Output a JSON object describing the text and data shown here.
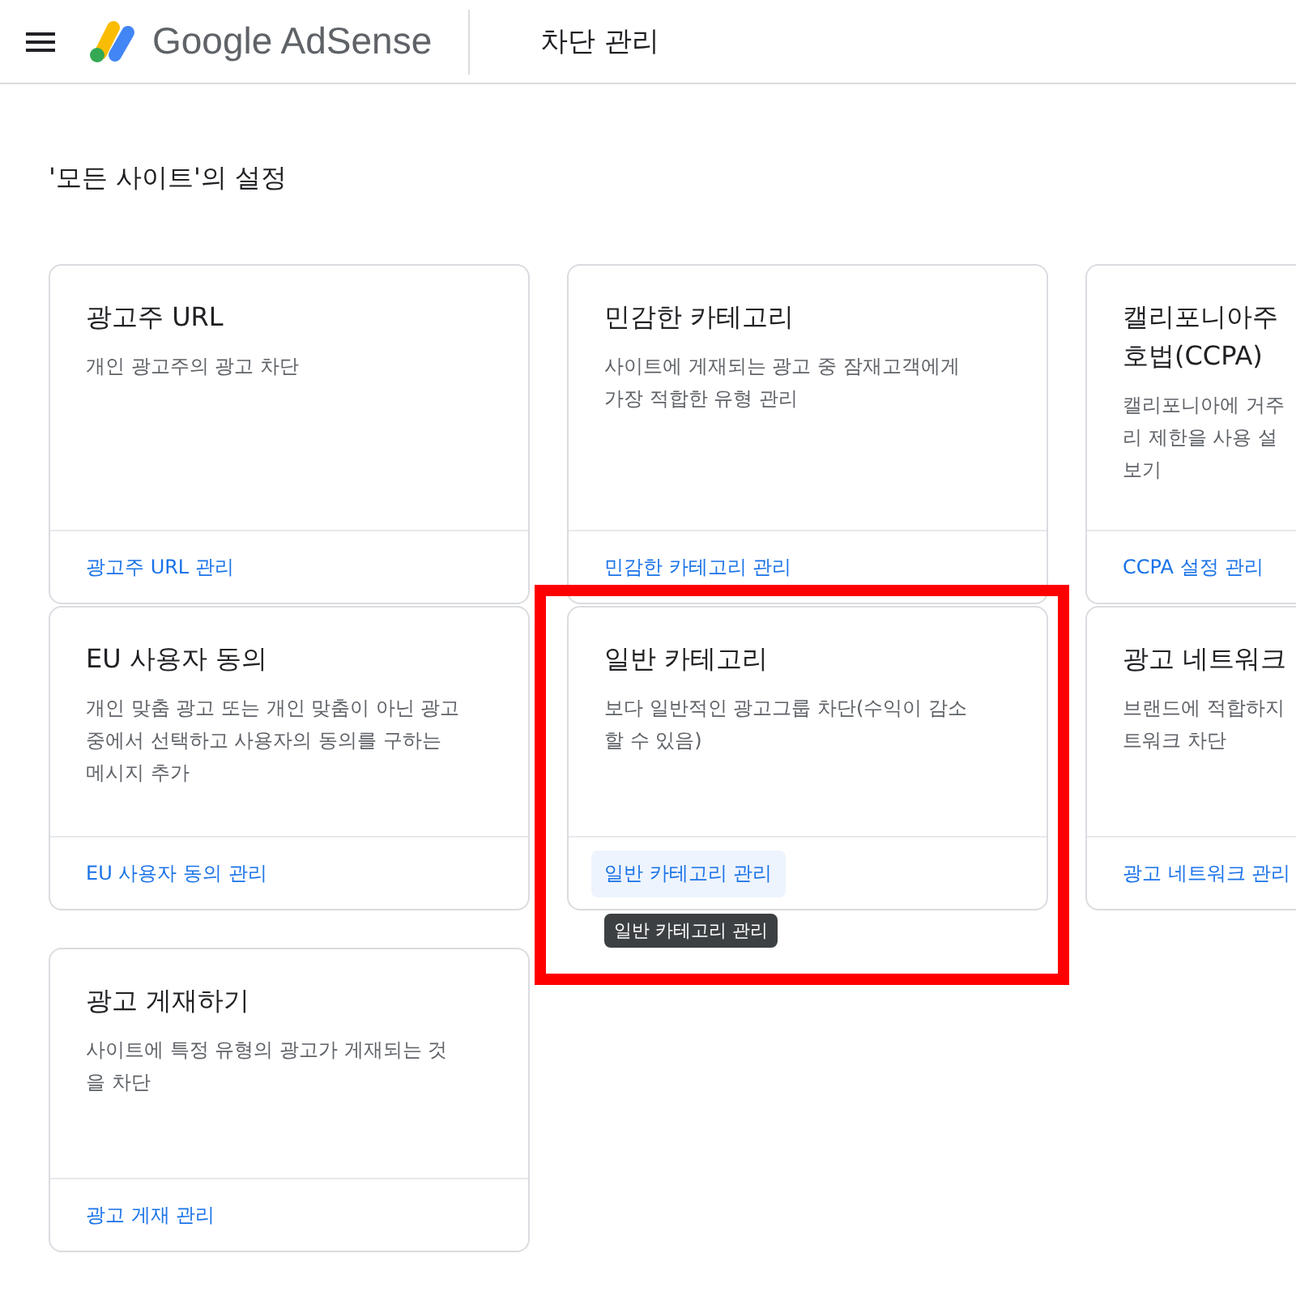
{
  "header": {
    "product": "Google AdSense",
    "page_title": "차단 관리"
  },
  "section_title": "'모든 사이트'의 설정",
  "cards": [
    {
      "title": "광고주 URL",
      "description": "개인 광고주의 광고 차단",
      "link": "광고주 URL 관리",
      "hovered": false,
      "highlighted": false
    },
    {
      "title": "민감한 카테고리",
      "description": "사이트에 게재되는 광고 중 잠재고객에게\n가장 적합한 유형 관리",
      "link": "민감한 카테고리 관리",
      "hovered": false,
      "highlighted": false
    },
    {
      "title": "캘리포니아주\n호법(CCPA)",
      "description": "캘리포니아에 거주\n리 제한을 사용 설\n보기",
      "link": "CCPA 설정 관리",
      "hovered": false,
      "highlighted": false
    },
    {
      "title": "EU 사용자 동의",
      "description": "개인 맞춤 광고 또는 개인 맞춤이 아닌 광고\n중에서 선택하고 사용자의 동의를 구하는\n메시지 추가",
      "link": "EU 사용자 동의 관리",
      "hovered": false,
      "highlighted": false
    },
    {
      "title": "일반 카테고리",
      "description": "보다 일반적인 광고그룹 차단(수익이 감소\n할 수 있음)",
      "link": "일반 카테고리 관리",
      "hovered": true,
      "highlighted": true,
      "tooltip": "일반 카테고리 관리"
    },
    {
      "title": "광고 네트워크",
      "description": "브랜드에 적합하지\n트워크 차단",
      "link": "광고 네트워크 관리",
      "hovered": false,
      "highlighted": false
    },
    {
      "title": "광고 게재하기",
      "description": "사이트에 특정 유형의 광고가 게재되는 것\n을 차단",
      "link": "광고 게재 관리",
      "hovered": false,
      "highlighted": false
    }
  ]
}
